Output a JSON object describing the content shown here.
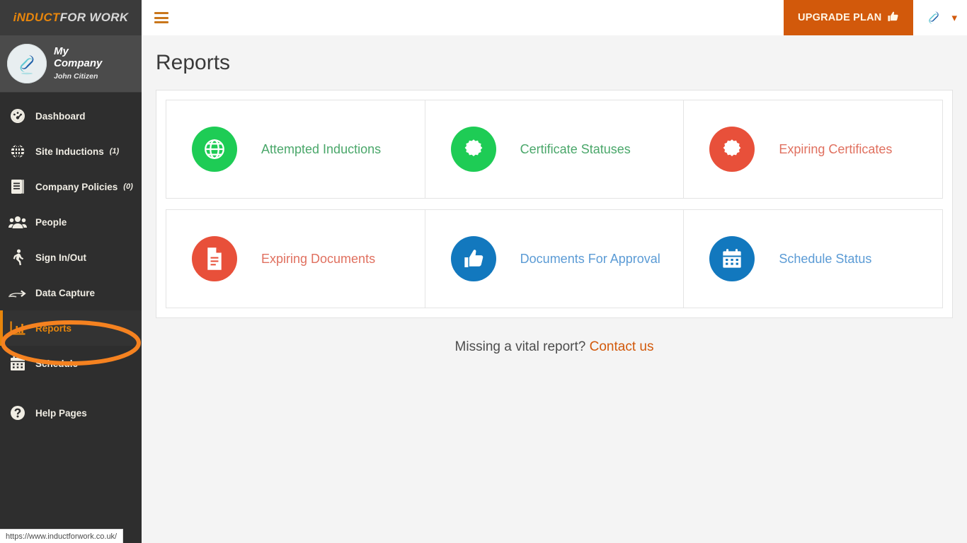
{
  "brand": {
    "part1": "iNDUCT",
    "part2": "FOR WORK"
  },
  "company": {
    "name": "My Company",
    "user": "John Citizen"
  },
  "sidebar": {
    "items": [
      {
        "label": "Dashboard",
        "icon": "dashboard-gauge-icon",
        "count": ""
      },
      {
        "label": "Site Inductions",
        "icon": "globe-icon",
        "count": "(1)"
      },
      {
        "label": "Company Policies",
        "icon": "book-icon",
        "count": "(0)"
      },
      {
        "label": "People",
        "icon": "people-icon",
        "count": ""
      },
      {
        "label": "Sign In/Out",
        "icon": "walking-person-icon",
        "count": ""
      },
      {
        "label": "Data Capture",
        "icon": "hand-icon",
        "count": ""
      },
      {
        "label": "Reports",
        "icon": "bar-chart-icon",
        "count": ""
      },
      {
        "label": "Schedule",
        "icon": "calendar-icon",
        "count": ""
      },
      {
        "label": "Help Pages",
        "icon": "question-circle-icon",
        "count": ""
      }
    ],
    "active": "Reports"
  },
  "topbar": {
    "menu_icon": "hamburger-icon",
    "upgrade_label": "UPGRADE PLAN",
    "upgrade_icon": "thumbs-up-icon",
    "user_icon": "company-logo-icon",
    "caret_icon": "chevron-down-icon"
  },
  "main": {
    "title": "Reports",
    "cards": [
      {
        "label": "Attempted Inductions",
        "icon": "globe-icon",
        "circle_color": "#1ecc55",
        "text_color": "#4aa76a"
      },
      {
        "label": "Certificate Statuses",
        "icon": "certificate-icon",
        "circle_color": "#1ecc55",
        "text_color": "#4aa76a"
      },
      {
        "label": "Expiring Certificates",
        "icon": "certificate-icon",
        "circle_color": "#e8503a",
        "text_color": "#e0705f"
      },
      {
        "label": "Expiring Documents",
        "icon": "document-icon",
        "circle_color": "#e8503a",
        "text_color": "#e0705f"
      },
      {
        "label": "Documents For Approval",
        "icon": "thumbs-up-icon",
        "circle_color": "#1278be",
        "text_color": "#5b9bd5"
      },
      {
        "label": "Schedule Status",
        "icon": "calendar-icon",
        "circle_color": "#1278be",
        "text_color": "#5b9bd5"
      }
    ],
    "footer_text": "Missing a vital report?",
    "footer_link": "Contact us"
  },
  "statusbar": {
    "url": "https://www.inductforwork.co.uk/"
  },
  "annotation": {
    "shape": "ellipse-highlight",
    "color": "#f58220",
    "target": "Reports"
  }
}
